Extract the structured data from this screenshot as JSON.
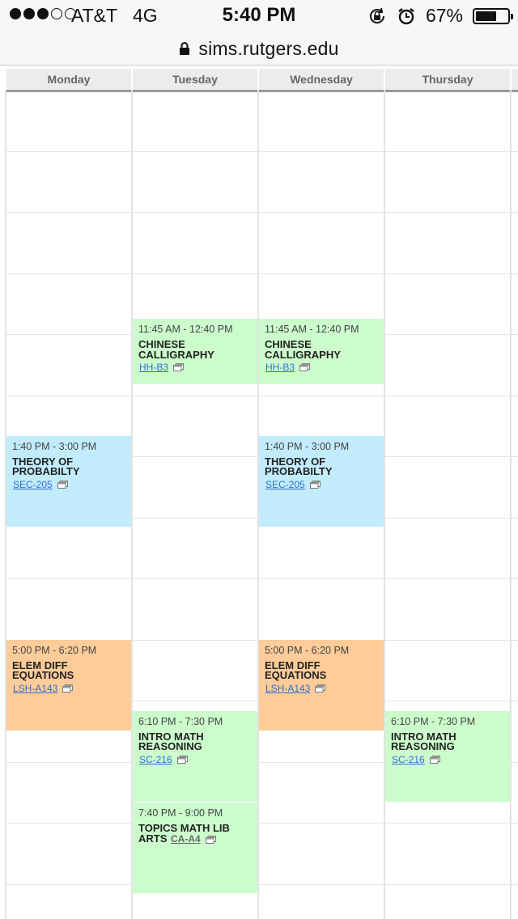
{
  "status_bar": {
    "signal_dots": [
      true,
      true,
      true,
      false,
      false
    ],
    "carrier": "AT&T",
    "network": "4G",
    "time": "5:40 PM",
    "battery_percent": "67%",
    "battery_level": 0.67
  },
  "url_bar": {
    "url": "sims.rutgers.edu"
  },
  "calendar": {
    "days": [
      "Monday",
      "Tuesday",
      "Wednesday",
      "Thursday",
      ""
    ],
    "events": [
      {
        "day": "Tuesday",
        "time": "11:45 AM - 12:40 PM",
        "title": "CHINESE CALLIGRAPHY",
        "room": "HH-B3",
        "color": "#ccfccc"
      },
      {
        "day": "Wednesday",
        "time": "11:45 AM - 12:40 PM",
        "title": "CHINESE CALLIGRAPHY",
        "room": "HH-B3",
        "color": "#ccfccc"
      },
      {
        "day": "Monday",
        "time": "1:40 PM - 3:00 PM",
        "title": "THEORY OF PROBABILTY",
        "room": "SEC-205",
        "color": "#c2ecfc"
      },
      {
        "day": "Wednesday",
        "time": "1:40 PM - 3:00 PM",
        "title": "THEORY OF PROBABILTY",
        "room": "SEC-205",
        "color": "#c2ecfc"
      },
      {
        "day": "Monday",
        "time": "5:00 PM - 6:20 PM",
        "title": "ELEM DIFF EQUATIONS",
        "room": "LSH-A143",
        "color": "#fdcc99"
      },
      {
        "day": "Wednesday",
        "time": "5:00 PM - 6:20 PM",
        "title": "ELEM DIFF EQUATIONS",
        "room": "LSH-A143",
        "color": "#fdcc99"
      },
      {
        "day": "Tuesday",
        "time": "6:10 PM - 7:30 PM",
        "title": "INTRO MATH REASONING",
        "room": "SC-216",
        "color": "#ccfccc"
      },
      {
        "day": "Thursday",
        "time": "6:10 PM - 7:30 PM",
        "title": "INTRO MATH REASONING",
        "room": "SC-216",
        "color": "#ccfccc"
      },
      {
        "day": "Tuesday",
        "time": "7:40 PM - 9:00 PM",
        "title": "TOPICS MATH LIB ARTS",
        "room": "CA-A4",
        "color": "#ccfccc"
      }
    ]
  }
}
